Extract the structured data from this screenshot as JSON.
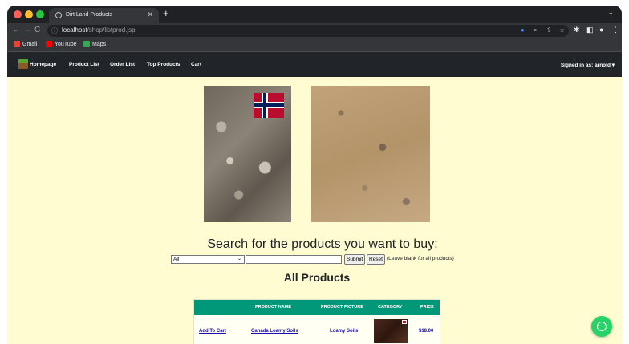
{
  "browser": {
    "tab_title": "Dirt Land Products",
    "tab_close": "✕",
    "new_tab": "+",
    "url_host": "localhost",
    "url_path": "/shop/listprod.jsp",
    "bookmarks": [
      {
        "label": "Gmail",
        "color": "#ea4335"
      },
      {
        "label": "YouTube",
        "color": "#ff0000"
      },
      {
        "label": "Maps",
        "color": "#34a853"
      }
    ]
  },
  "navbar": {
    "brand": "Homepage",
    "links": [
      "Product List",
      "Order List",
      "Top Products",
      "Cart"
    ],
    "signed_in": "Signed in as: arnold ▾"
  },
  "search": {
    "heading": "Search for the products you want to buy:",
    "category_selected": "All",
    "submit_label": "Submit",
    "reset_label": "Reset",
    "hint": "(Leave blank for all products)"
  },
  "products": {
    "heading": "All Products",
    "columns": [
      "PRODUCT NAME",
      "PRODUCT PICTURE",
      "CATEGORY",
      "PRICE"
    ],
    "rows": [
      {
        "action": "Add To Cart",
        "name": "Canada Loamy Soils",
        "category": "Loamy Soils",
        "price": "$18.00"
      }
    ]
  },
  "colors": {
    "page_bg": "#fffcd2",
    "navbar_bg": "#212529",
    "table_header": "#009879",
    "whatsapp": "#25d366"
  },
  "icons": [
    "globe-icon",
    "back-icon",
    "forward-icon",
    "reload-icon",
    "info-icon",
    "google-icon",
    "zoom-icon",
    "share-icon",
    "star-icon",
    "extensions-icon",
    "sidepanel-icon",
    "profile-icon",
    "menu-icon",
    "whatsapp-icon"
  ]
}
